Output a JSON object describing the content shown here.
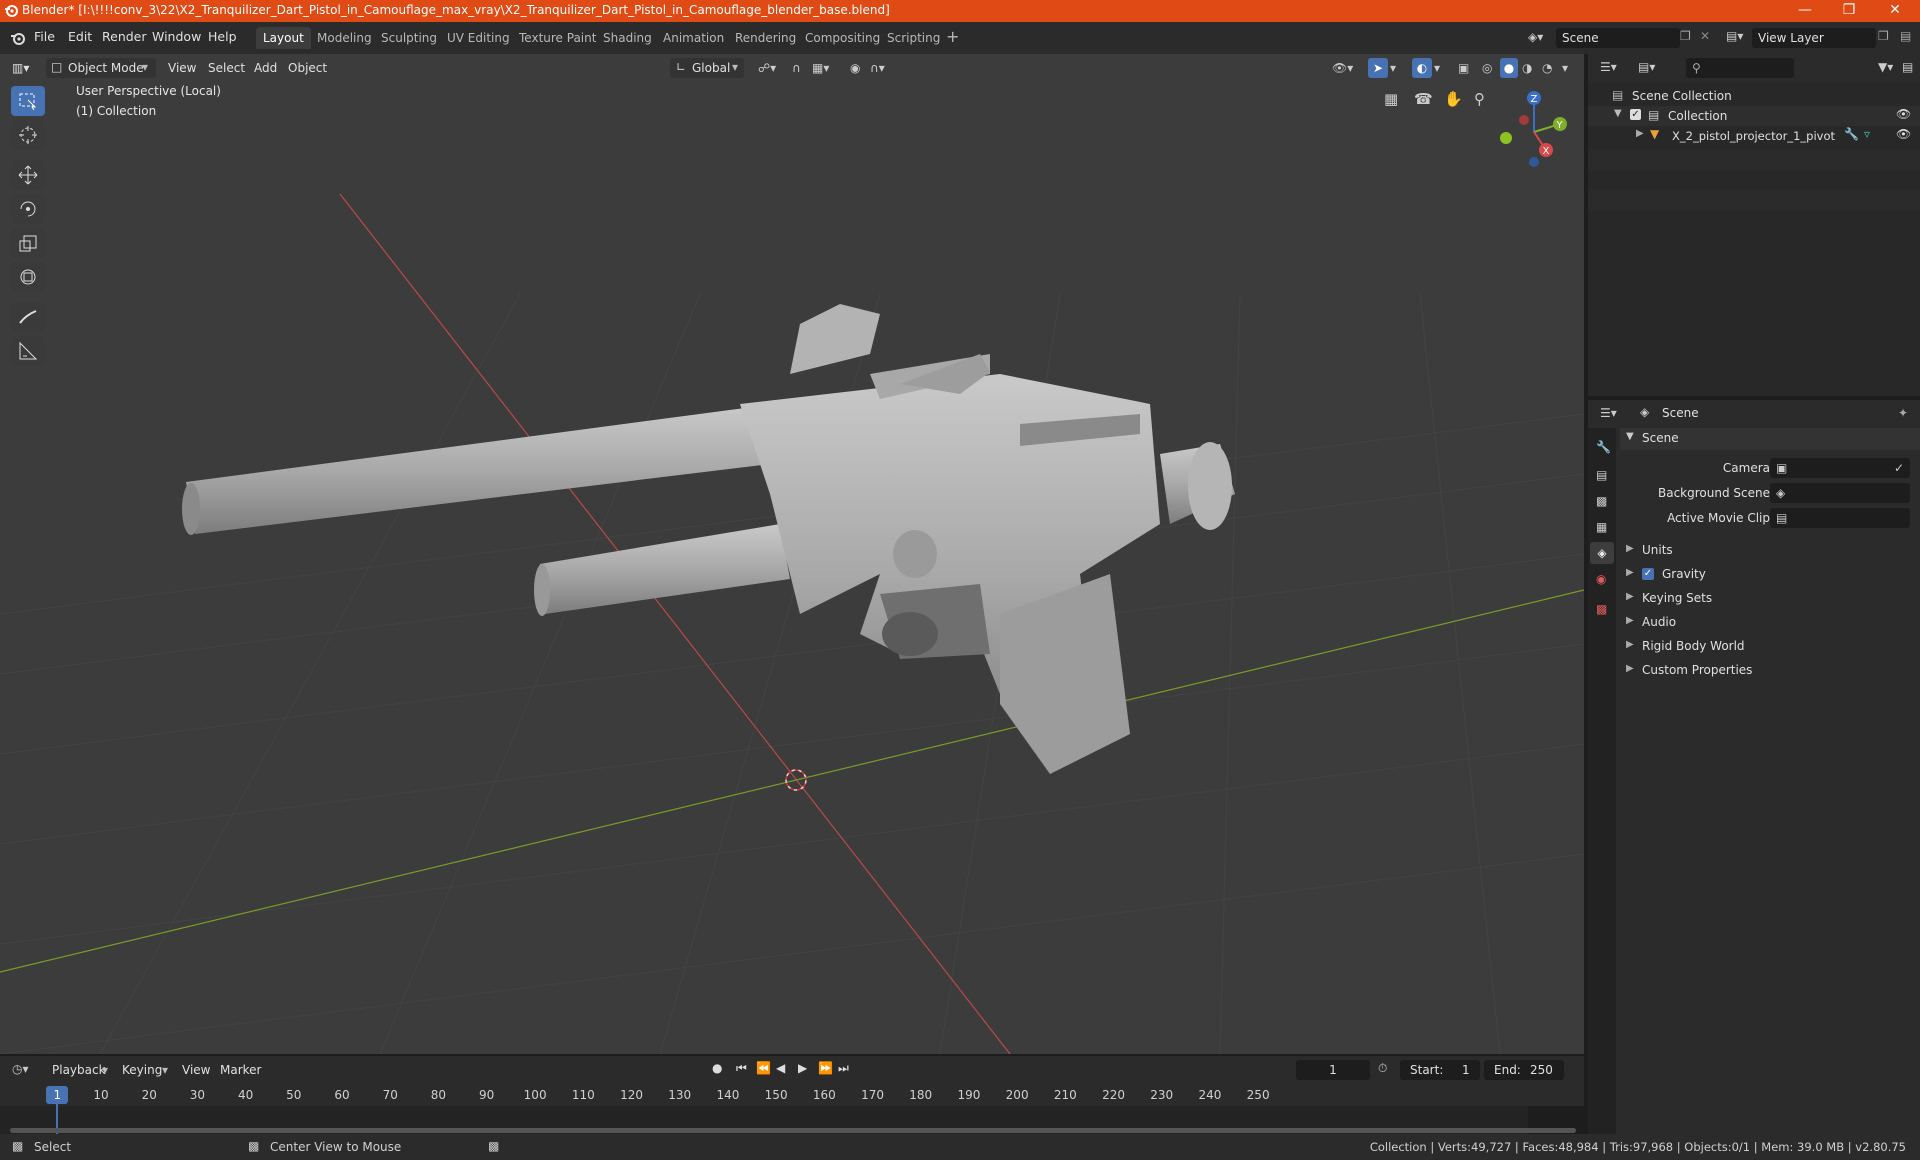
{
  "titlebar": {
    "title": "Blender* [I:\\!!!!conv_3\\22\\X2_Tranquilizer_Dart_Pistol_in_Camouflage_max_vray\\X2_Tranquilizer_Dart_Pistol_in_Camouflage_blender_base.blend]"
  },
  "menus": [
    "File",
    "Edit",
    "Render",
    "Window",
    "Help"
  ],
  "workspaces": [
    "Layout",
    "Modeling",
    "Sculpting",
    "UV Editing",
    "Texture Paint",
    "Shading",
    "Animation",
    "Rendering",
    "Compositing",
    "Scripting"
  ],
  "scene_field": "Scene",
  "view_layer_field": "View Layer",
  "viewport": {
    "mode": "Object Mode",
    "menus": [
      "View",
      "Select",
      "Add",
      "Object"
    ],
    "transform_orientation": "Global",
    "info_line1": "User Perspective (Local)",
    "info_line2": "(1) Collection",
    "gizmo": {
      "z": "Z",
      "y": "Y",
      "x": "X"
    }
  },
  "outliner": {
    "root": "Scene Collection",
    "collection": "Collection",
    "object": "X_2_pistol_projector_1_pivot"
  },
  "properties": {
    "header": "Scene",
    "panel_title": "Scene",
    "camera_label": "Camera",
    "background_scene_label": "Background Scene",
    "active_movie_clip_label": "Active Movie Clip",
    "sections": [
      "Units",
      "Gravity",
      "Keying Sets",
      "Audio",
      "Rigid Body World",
      "Custom Properties"
    ]
  },
  "timeline": {
    "menus": [
      "Playback",
      "Keying",
      "View",
      "Marker"
    ],
    "current_frame": "1",
    "start_label": "Start:",
    "start": "1",
    "end_label": "End:",
    "end": "250",
    "ticks": [
      "1",
      "10",
      "20",
      "30",
      "40",
      "50",
      "60",
      "70",
      "80",
      "90",
      "100",
      "110",
      "120",
      "130",
      "140",
      "150",
      "160",
      "170",
      "180",
      "190",
      "200",
      "210",
      "220",
      "230",
      "240",
      "250"
    ]
  },
  "statusbar": {
    "select": "Select",
    "center": "Center View to Mouse",
    "stats": "Collection | Verts:49,727 | Faces:48,984 | Tris:97,968 | Objects:0/1 | Mem: 39.0 MB | v2.80.75"
  }
}
